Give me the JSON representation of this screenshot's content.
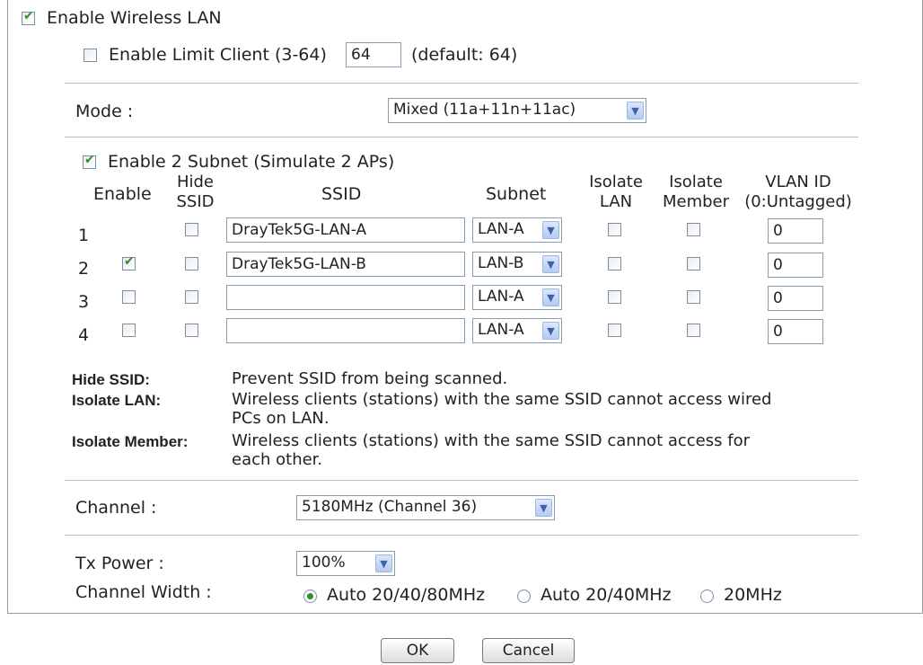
{
  "wireless": {
    "enable_label": "Enable Wireless LAN",
    "enable_checked": true
  },
  "limit_client": {
    "label": "Enable Limit Client (3-64)",
    "value": "64",
    "default_text": "(default: 64)",
    "checked": false
  },
  "mode": {
    "label": "Mode :",
    "value": "Mixed (11a+11n+11ac)"
  },
  "subnet": {
    "label": "Enable 2 Subnet (Simulate 2 APs)",
    "checked": true
  },
  "table": {
    "headers": {
      "enable": "Enable",
      "hide_ssid_1": "Hide",
      "hide_ssid_2": "SSID",
      "ssid": "SSID",
      "subnet": "Subnet",
      "isolate_lan_1": "Isolate",
      "isolate_lan_2": "LAN",
      "isolate_member_1": "Isolate",
      "isolate_member_2": "Member",
      "vlan_1": "VLAN ID",
      "vlan_2": "(0:Untagged)"
    },
    "rows": [
      {
        "num": "1",
        "enable": null,
        "hide": false,
        "ssid": "DrayTek5G-LAN-A",
        "subnet": "LAN-A",
        "isolate_lan": false,
        "isolate_member": false,
        "vlan": "0"
      },
      {
        "num": "2",
        "enable": true,
        "hide": false,
        "ssid": "DrayTek5G-LAN-B",
        "subnet": "LAN-B",
        "isolate_lan": false,
        "isolate_member": false,
        "vlan": "0"
      },
      {
        "num": "3",
        "enable": false,
        "hide": false,
        "ssid": "",
        "subnet": "LAN-A",
        "isolate_lan": false,
        "isolate_member": false,
        "vlan": "0"
      },
      {
        "num": "4",
        "enable": false,
        "hide": false,
        "ssid": "",
        "subnet": "LAN-A",
        "isolate_lan": false,
        "isolate_member": false,
        "vlan": "0"
      }
    ]
  },
  "notes": {
    "hide_ssid_term": "Hide SSID:",
    "hide_ssid_desc": "Prevent SSID from being scanned.",
    "isolate_lan_term": "Isolate LAN:",
    "isolate_lan_desc_1": "Wireless clients (stations) with the same SSID cannot access wired",
    "isolate_lan_desc_2": "PCs on LAN.",
    "isolate_member_term": "Isolate Member:",
    "isolate_member_desc_1": "Wireless clients (stations) with the same SSID cannot access for",
    "isolate_member_desc_2": "each other."
  },
  "channel": {
    "label": "Channel :",
    "value": "5180MHz (Channel 36)"
  },
  "tx_power": {
    "label": "Tx Power :",
    "value": "100%"
  },
  "channel_width": {
    "label": "Channel Width :",
    "options": [
      "Auto 20/40/80MHz",
      "Auto 20/40MHz",
      "20MHz"
    ],
    "selected": "Auto 20/40/80MHz"
  },
  "buttons": {
    "ok": "OK",
    "cancel": "Cancel"
  },
  "colors": {
    "check": "#2f8f2f",
    "arrow": "#3a62b0"
  }
}
